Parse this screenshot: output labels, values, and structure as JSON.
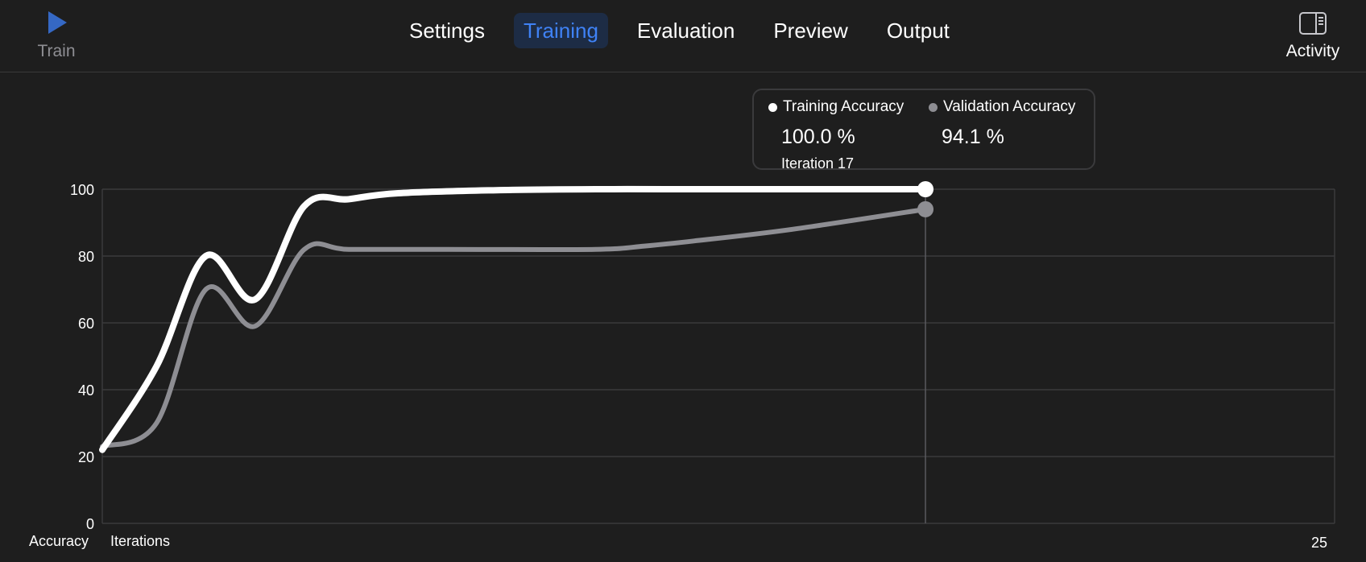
{
  "toolbar": {
    "train": {
      "label": "Train",
      "icon": "play-icon"
    },
    "tabs": [
      {
        "label": "Settings",
        "active": false
      },
      {
        "label": "Training",
        "active": true
      },
      {
        "label": "Evaluation",
        "active": false
      },
      {
        "label": "Preview",
        "active": false
      },
      {
        "label": "Output",
        "active": false
      }
    ],
    "activity": {
      "label": "Activity",
      "icon": "sidebar-panel-icon"
    }
  },
  "legend": {
    "training": {
      "label": "Training Accuracy",
      "value": "100.0 %",
      "iteration": "Iteration 17"
    },
    "validation": {
      "label": "Validation Accuracy",
      "value": "94.1 %"
    }
  },
  "chart_data": {
    "type": "line",
    "ylabel": "Accuracy",
    "xlabel": "Iterations",
    "xmax_label": "25",
    "xlim": [
      0,
      25
    ],
    "ylim": [
      0,
      100
    ],
    "yticks": [
      0,
      20,
      40,
      60,
      80,
      100
    ],
    "grid": true,
    "highlight_x": 16.7,
    "series": [
      {
        "name": "Training Accuracy",
        "color": "#ffffff",
        "x": [
          0,
          1.1,
          2.1,
          3.1,
          4.1,
          5.0,
          6.0,
          8.0,
          10.0,
          12.0,
          14.0,
          16.7
        ],
        "y": [
          22,
          47,
          80,
          67,
          95,
          97,
          98.8,
          99.7,
          100,
          100,
          100,
          100
        ]
      },
      {
        "name": "Validation Accuracy",
        "color": "#8e8e93",
        "x": [
          0,
          1.1,
          2.1,
          3.1,
          4.1,
          5.0,
          7.0,
          10.0,
          11.0,
          12.0,
          14.0,
          16.7
        ],
        "y": [
          23,
          30,
          70,
          59,
          82,
          82,
          82,
          82,
          83,
          84.5,
          88,
          94
        ]
      }
    ]
  },
  "colors": {
    "background": "#1e1e1e",
    "accent": "#3f82f6",
    "grid": "#3a3a3c"
  }
}
